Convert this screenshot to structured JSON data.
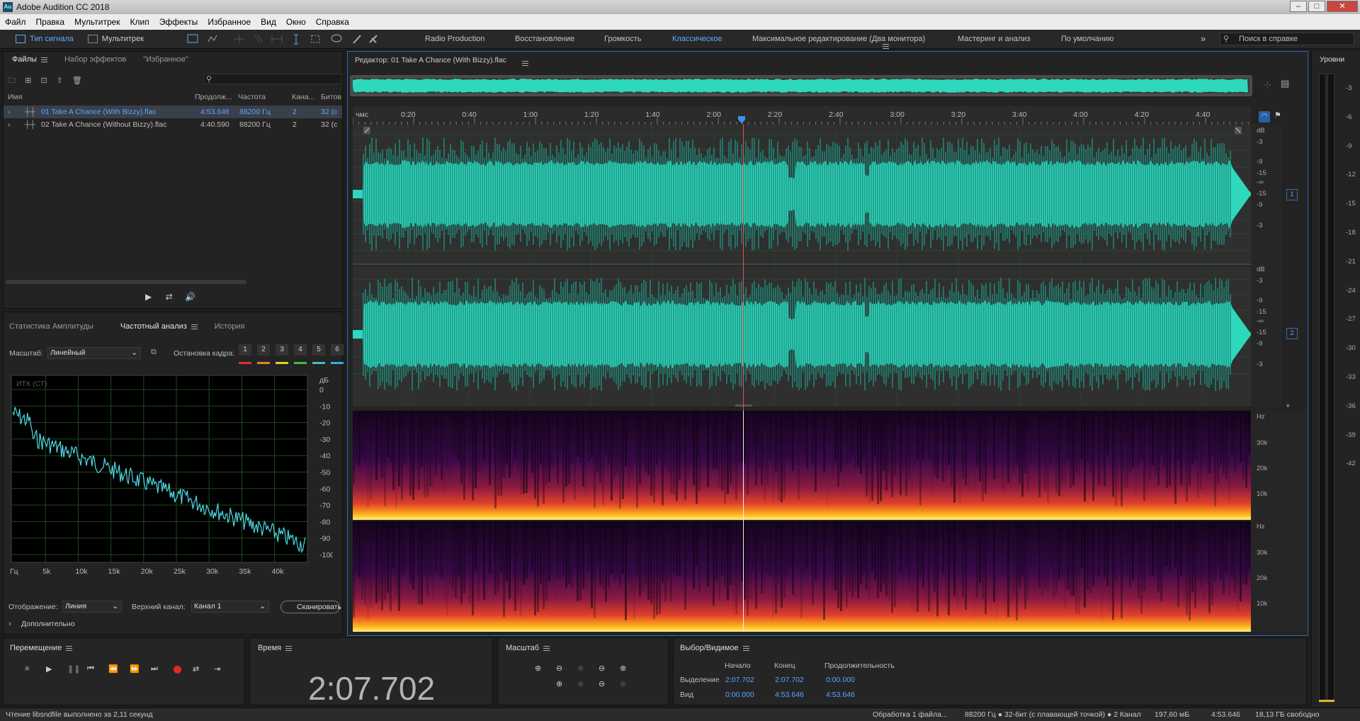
{
  "title": "Adobe Audition CC 2018",
  "menu": [
    "Файл",
    "Правка",
    "Мультитрек",
    "Клип",
    "Эффекты",
    "Избранное",
    "Вид",
    "Окно",
    "Справка"
  ],
  "toolbar": {
    "waveform_view": "Тип сигнала",
    "multitrack_view": "Мультитрек",
    "workspaces": [
      "Radio Production",
      "Восстановление",
      "Громкость",
      "Классическое",
      "Максимальное редактирование (Два монитора)",
      "Мастеринг и анализ",
      "По умолчанию"
    ],
    "active_workspace": "Классическое",
    "search_placeholder": "Поиск в справке"
  },
  "files_panel": {
    "tabs": [
      "Файлы",
      "Набор эффектов",
      "\"Избранное\""
    ],
    "columns": [
      "Имя",
      "Продолж...",
      "Частота",
      "Кана...",
      "Битов"
    ],
    "rows": [
      {
        "name": "01 Take A Chance (With Bizzy).flac",
        "duration": "4:53.646",
        "rate": "88200 Гц",
        "channels": "2",
        "bits": "32 (с"
      },
      {
        "name": "02 Take A Chance (Without Bizzy).flac",
        "duration": "4:40.590",
        "rate": "88200 Гц",
        "channels": "2",
        "bits": "32 (с"
      }
    ]
  },
  "analysis_panel": {
    "tabs": [
      "Статистика Амплитуды",
      "Частотный анализ",
      "История"
    ],
    "scale_label": "Масштаб:",
    "scale_value": "Линейный",
    "freeze_label": "Остановка кадра:",
    "freeze_buttons": [
      "1",
      "2",
      "3",
      "4",
      "5",
      "6"
    ],
    "freeze_colors": [
      "#e03030",
      "#e08a20",
      "#e0d020",
      "#40c040",
      "#40c0c0",
      "#30b0e0"
    ],
    "graph_label": "ИТК (СТ)",
    "db_ticks": [
      "дБ",
      "0",
      "-10",
      "-20",
      "-30",
      "-40",
      "-50",
      "-60",
      "-70",
      "-80",
      "-90",
      "-100"
    ],
    "freq_ticks": [
      "Гц",
      "5k",
      "10k",
      "15k",
      "20k",
      "25k",
      "30k",
      "35k",
      "40k"
    ],
    "display_label": "Отображение:",
    "display_value": "Линия",
    "channel_label": "Верхний канал:",
    "channel_value": "Канал 1",
    "scan_button": "Сканировать",
    "more_label": "Дополнительно"
  },
  "editor": {
    "title": "Редактор: 01 Take A Chance (With Bizzy).flac",
    "ruler_unit": "чмс",
    "ruler_ticks": [
      "0:20",
      "0:40",
      "1:00",
      "1:20",
      "1:40",
      "2:00",
      "2:20",
      "2:40",
      "3:00",
      "3:20",
      "3:40",
      "4:00",
      "4:20",
      "4:40"
    ],
    "db_scale_ch1": [
      "dB",
      "-3",
      "-9",
      "-15",
      "-∞",
      "-15",
      "-9",
      "-3"
    ],
    "db_scale_ch2": [
      "dB",
      "-3",
      "-9",
      "-15",
      "-∞",
      "-15",
      "-9",
      "-3"
    ],
    "channel_badges": [
      "1",
      "2"
    ],
    "hz_scale_ch1": [
      "Hz",
      "30k",
      "20k",
      "10k"
    ],
    "hz_scale_ch2": [
      "Hz",
      "30k",
      "20k",
      "10k"
    ],
    "playhead_fraction": 0.4346,
    "waveform_color": "#2ed8bd"
  },
  "levels": {
    "title": "Уровни",
    "ticks": [
      "-3",
      "-6",
      "-9",
      "-12",
      "-15",
      "-18",
      "-21",
      "-24",
      "-27",
      "-30",
      "-33",
      "-36",
      "-39",
      "-42"
    ]
  },
  "transport": {
    "title": "Перемещение"
  },
  "time_panel": {
    "title": "Время",
    "value": "2:07.702"
  },
  "zoom_panel": {
    "title": "Масштаб"
  },
  "selection_panel": {
    "title": "Выбор/Видимое",
    "col_start": "Начало",
    "col_end": "Конец",
    "col_duration": "Продолжительность",
    "row_selection": {
      "label": "Выделение",
      "start": "2:07.702",
      "end": "2:07.702",
      "duration": "0:00.000"
    },
    "row_view": {
      "label": "Вид",
      "start": "0:00.000",
      "end": "4:53.646",
      "duration": "4:53.646"
    }
  },
  "status": {
    "left": "Чтение libsndfile выполнено за 2,11 секунд",
    "processing": "Обработка 1 файла...",
    "format": "88200 Гц ● 32-бит (с плавающей точкой) ● 2 Канал",
    "size": "197,60 мБ",
    "duration": "4:53.646",
    "free": "18,13 ГБ свободно"
  }
}
